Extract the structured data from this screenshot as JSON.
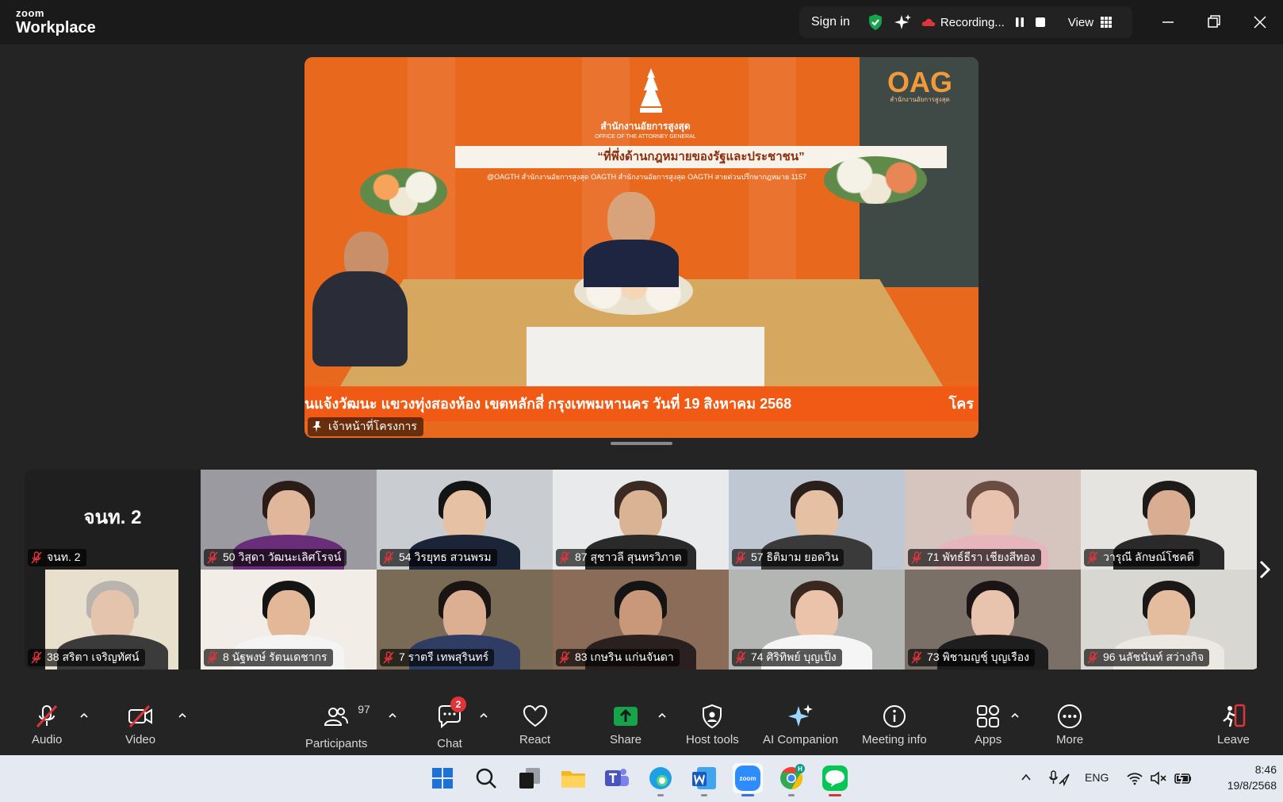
{
  "app": {
    "logo_small": "zoom",
    "logo_big": "Workplace"
  },
  "titlebar": {
    "sign_in": "Sign in",
    "recording": "Recording...",
    "view": "View"
  },
  "main_video": {
    "org_name_th": "สำนักงานอัยการสูงสุด",
    "org_name_en": "OFFICE OF THE ATTORNEY GENERAL",
    "slogan": "“ที่พึ่งด้านกฎหมายของรัฐและประชาชน”",
    "social": "@OAGTH   สำนักงานอัยการสูงสุด OAGTH   สำนักงานอัยการสูงสุด OAGTH   สายด่วนปรึกษากฎหมาย 1157",
    "oag_logo": "OAG",
    "oag_sub": "สำนักงานอัยการสูงสุด",
    "ticker_left": "นแจ้งวัฒนะ แขวงทุ่งสองห้อง เขตหลักสี่ กรุงเทพมหานคร วันที่ 19 สิงหาคม 2568",
    "ticker_right": "โคร",
    "speaker_name": "เจ้าหน้าที่โครงการ"
  },
  "gallery": {
    "tiles": [
      {
        "name": "จนท. 2",
        "display": "จนท. 2"
      },
      {
        "name": "50 วิสุดา วัฒนะเลิศโรจน์"
      },
      {
        "name": "54 วิรยุทธ สวนพรม"
      },
      {
        "name": "87 สุชาวลี สุนทรวิภาต"
      },
      {
        "name": "57 ธิติมาม ยอดวิน"
      },
      {
        "name": "71 พัทธ์ธีรา เชียงสีทอง"
      },
      {
        "name": "วารุณี ลักษณ์โชคดี"
      },
      {
        "name": "38 สริตา เจริญทัศน์"
      },
      {
        "name": "8 นัฐพงษ์ รัตนเดชากร"
      },
      {
        "name": "7 ราตรี เทพสุรินทร์"
      },
      {
        "name": "83 เกษริน แก่นจันดา"
      },
      {
        "name": "74 ศิริทิพย์ บุญเป็ง"
      },
      {
        "name": "73 พิชามญชุ์ บุญเรือง"
      },
      {
        "name": "96 นลัชนันท์ สว่างกิจ"
      }
    ]
  },
  "toolbar": {
    "audio": "Audio",
    "video": "Video",
    "participants": "Participants",
    "participant_count": "97",
    "chat": "Chat",
    "chat_badge": "2",
    "react": "React",
    "share": "Share",
    "host_tools": "Host tools",
    "ai_companion": "AI Companion",
    "meeting_info": "Meeting info",
    "apps": "Apps",
    "more": "More",
    "leave": "Leave"
  },
  "taskbar": {
    "language": "ENG",
    "time": "8:46",
    "date": "19/8/2568"
  },
  "colors": {
    "accent_green": "#17a34a",
    "mute_red": "#e0343b",
    "oag_orange": "#f05a14"
  }
}
